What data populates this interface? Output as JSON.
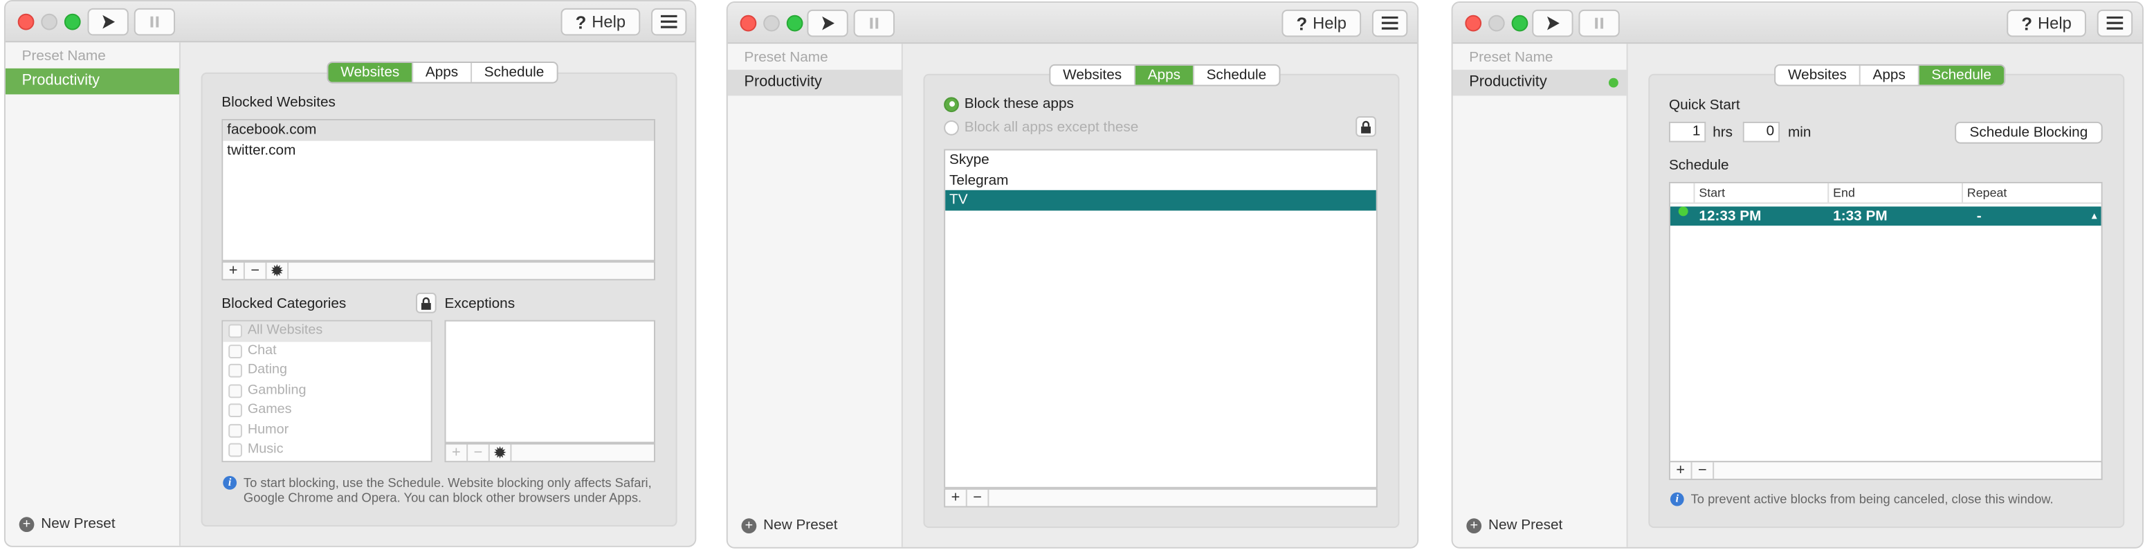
{
  "toolbar": {
    "help_label": "Help"
  },
  "sidebar": {
    "header": "Preset Name",
    "preset": "Productivity",
    "new_preset": "New Preset"
  },
  "tabs": [
    "Websites",
    "Apps",
    "Schedule"
  ],
  "websites": {
    "blocked_title": "Blocked Websites",
    "sites": [
      "facebook.com",
      "twitter.com"
    ],
    "categories_title": "Blocked Categories",
    "exceptions_title": "Exceptions",
    "categories": [
      "All Websites",
      "Chat",
      "Dating",
      "Gambling",
      "Games",
      "Humor",
      "Music"
    ],
    "info_line1": "To start blocking, use the Schedule. Website blocking only affects Safari,",
    "info_line2": "Google Chrome and Opera. You can block other browsers under Apps."
  },
  "apps": {
    "radio_block": "Block these apps",
    "radio_except": "Block all apps except these",
    "list": [
      "Skype",
      "Telegram",
      "TV"
    ]
  },
  "schedule": {
    "quick_start": "Quick Start",
    "hrs_value": "1",
    "hrs_label": "hrs",
    "min_value": "0",
    "min_label": "min",
    "schedule_button": "Schedule Blocking",
    "schedule_title": "Schedule",
    "columns": [
      "Start",
      "End",
      "Repeat"
    ],
    "row": {
      "start": "12:33 PM",
      "end": "1:33 PM",
      "repeat": "-"
    },
    "info": "To prevent active blocks from being canceled, close this window."
  },
  "colors": {
    "accent_green": "#5fae45",
    "selection_teal": "#15797b"
  }
}
